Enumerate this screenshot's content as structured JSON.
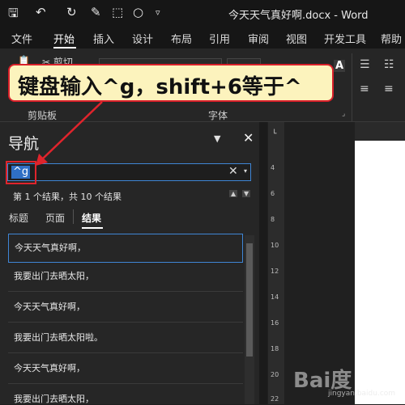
{
  "window": {
    "title": "今天天气真好啊.docx  -  Word"
  },
  "ribbon": {
    "tabs": [
      "文件",
      "开始",
      "插入",
      "设计",
      "布局",
      "引用",
      "审阅",
      "视图",
      "开发工具",
      "帮助"
    ],
    "active_tab": "开始",
    "groups": {
      "clipboard": "剪贴板",
      "font": "字体"
    },
    "cut_label": "剪切",
    "font_icon_letter": "A"
  },
  "annotation": {
    "text": "键盘输入^g，shift+6等于^"
  },
  "navigation": {
    "title": "导航",
    "search_value": "^g",
    "result_count": "第 1 个结果，共 10 个结果",
    "tabs": [
      "标题",
      "页面",
      "结果"
    ],
    "active_tab": "结果",
    "results": [
      "今天天气真好啊，",
      "我要出门去晒太阳，",
      "今天天气真好啊，",
      "我要出门去晒太阳啦。",
      "今天天气真好啊，",
      "我要出门去晒太阳，"
    ]
  },
  "ruler": {
    "marks": [
      "4",
      "6",
      "8",
      "10",
      "12",
      "14",
      "16",
      "18",
      "20",
      "22"
    ]
  },
  "watermark": {
    "text": "Bai度",
    "sub": "jingyan.baidu.com"
  },
  "colors": {
    "accent": "#3f86d6",
    "annotation_border": "#d9202a",
    "annotation_fill": "#fcf3bd"
  }
}
